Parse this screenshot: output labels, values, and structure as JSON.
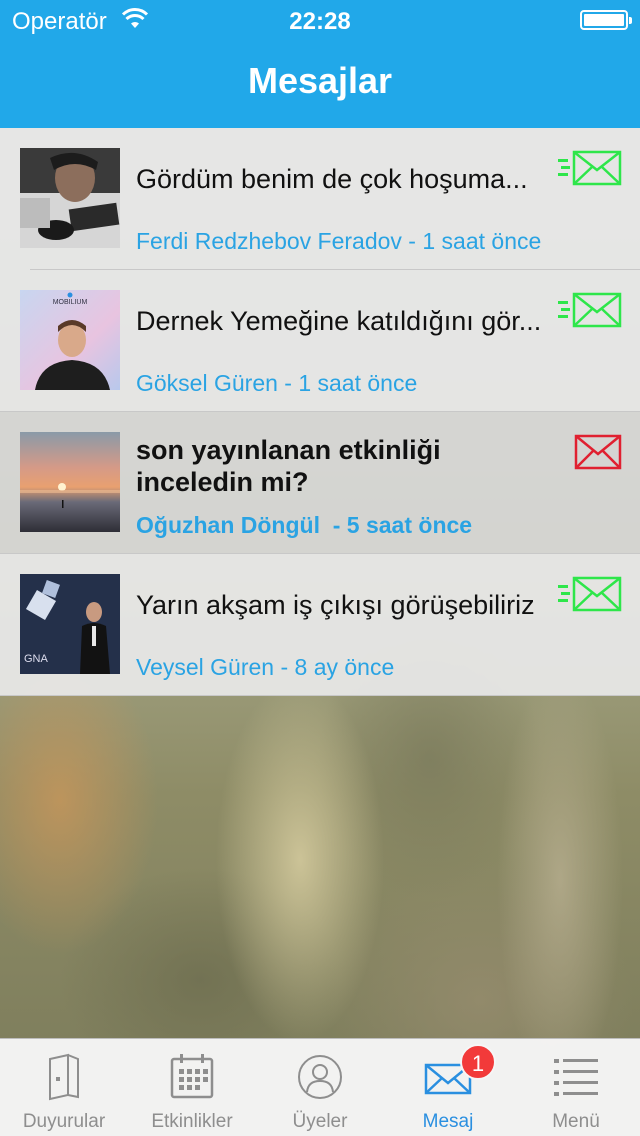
{
  "status_bar": {
    "carrier": "Operatör",
    "time": "22:28"
  },
  "nav": {
    "title": "Mesajlar"
  },
  "messages": [
    {
      "text": "Gördüm benim de çok hoşuma...",
      "meta": "Ferdi Redzhebov Feradov - 1 saat önce",
      "read": true
    },
    {
      "text": "Dernek Yemeğine katıldığını gör...",
      "meta": "Göksel Güren - 1 saat önce",
      "read": true
    },
    {
      "text": "son yayınlanan etkinliği inceledin mi?",
      "meta": "Oğuzhan Döngül  - 5 saat önce",
      "read": false
    },
    {
      "text": "Yarın akşam iş çıkışı görüşebiliriz",
      "meta": "Veysel Güren - 8 ay önce",
      "read": true
    }
  ],
  "tabs": [
    {
      "label": "Duyurular",
      "icon": "document-icon"
    },
    {
      "label": "Etkinlikler",
      "icon": "calendar-icon"
    },
    {
      "label": "Üyeler",
      "icon": "user-icon"
    },
    {
      "label": "Mesaj",
      "icon": "mail-icon"
    },
    {
      "label": "Menü",
      "icon": "list-icon"
    }
  ],
  "badge": {
    "count": "1"
  },
  "colors": {
    "accent": "#21a8e9",
    "read_icon": "#2ee64a",
    "unread_icon": "#e02030",
    "meta_text": "#2aa3e3"
  }
}
